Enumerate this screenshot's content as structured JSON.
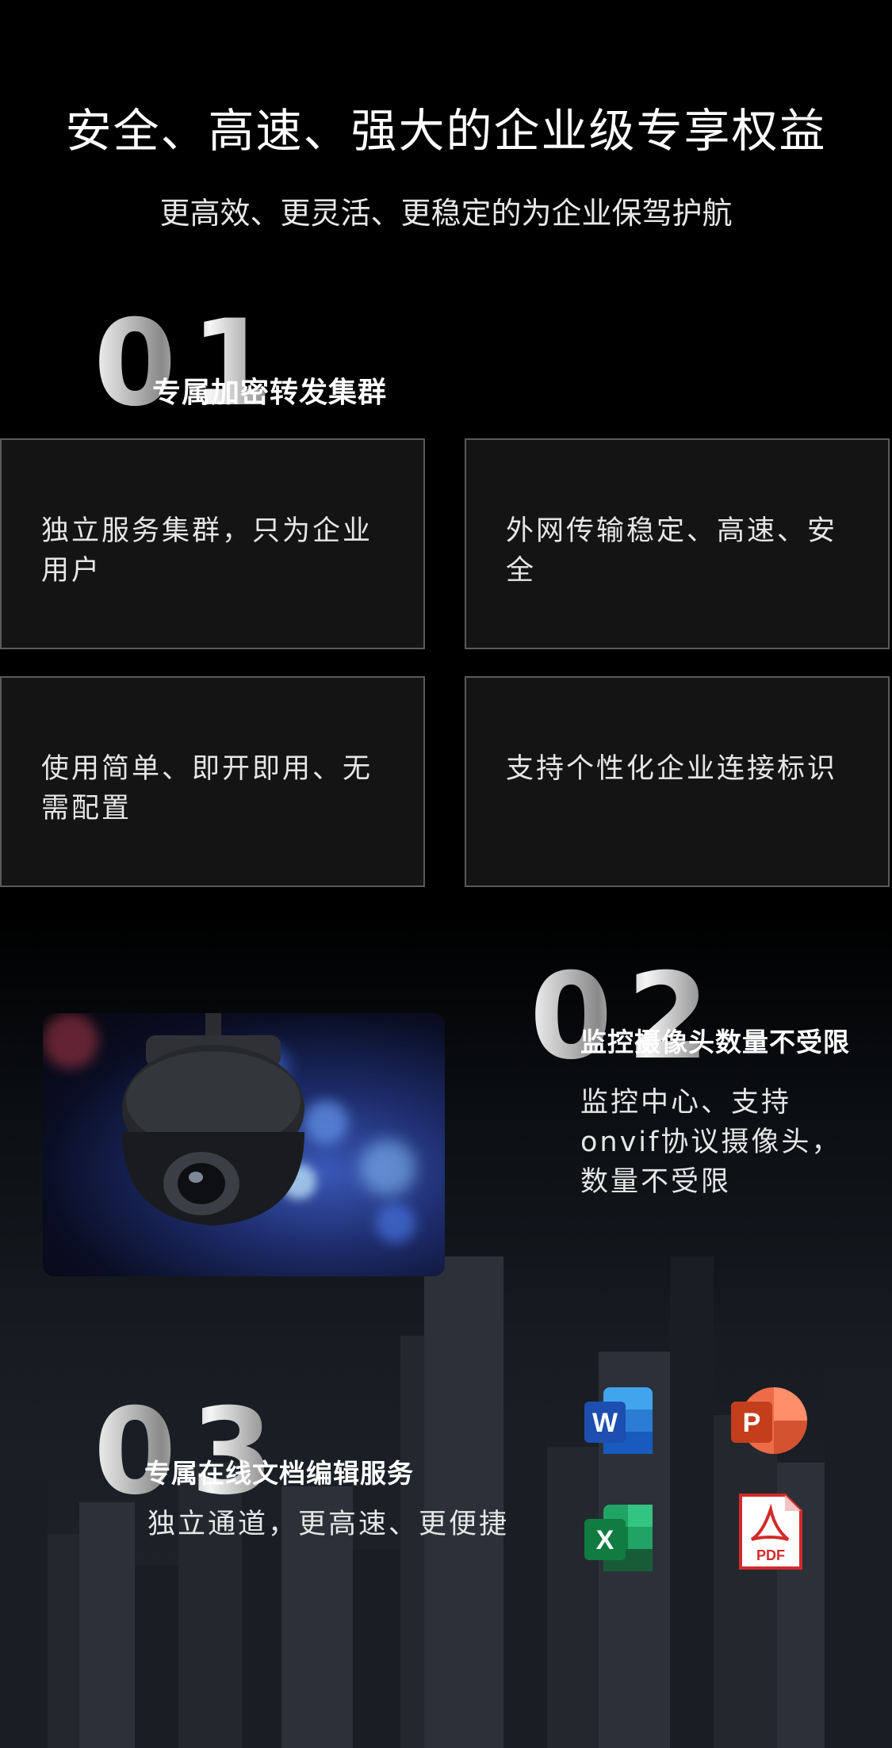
{
  "header": {
    "title": "安全、高速、强大的企业级专享权益",
    "subtitle": "更高效、更灵活、更稳定的为企业保驾护航"
  },
  "section1": {
    "number": "01",
    "title": "专属加密转发集群",
    "cards": [
      "独立服务集群，只为企业用户",
      "外网传输稳定、高速、安全",
      "使用简单、即开即用、无需配置",
      "支持个性化企业连接标识"
    ]
  },
  "section2": {
    "number": "02",
    "title": "监控摄像头数量不受限",
    "description_lines": [
      "监控中心、支持",
      "onvif协议摄像头，",
      "数量不受限"
    ]
  },
  "section3": {
    "number": "03",
    "title": "专属在线文档编辑服务",
    "description": "独立通道，更高速、更便捷",
    "icons": [
      {
        "name": "word-icon",
        "letter": "W",
        "color": "#2b5fc9"
      },
      {
        "name": "powerpoint-icon",
        "letter": "P",
        "color": "#d0492a"
      },
      {
        "name": "excel-icon",
        "letter": "X",
        "color": "#1f7a46"
      },
      {
        "name": "pdf-icon",
        "letter": "PDF",
        "color": "#d32a2a"
      }
    ]
  }
}
